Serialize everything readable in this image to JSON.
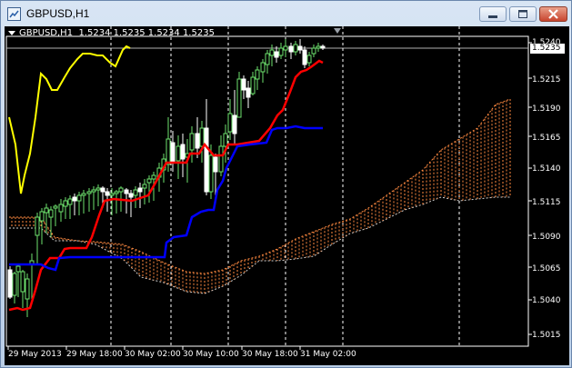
{
  "window": {
    "title": "GBPUSD,H1"
  },
  "ohlc": {
    "symbol": "GBPUSD,H1",
    "values": "1.5234 1.5235 1.5234 1.5235"
  },
  "current_price": "1.5235",
  "price_axis": [
    "1.5240",
    "1.5215",
    "1.5190",
    "1.5165",
    "1.5140",
    "1.5115",
    "1.5090",
    "1.5065",
    "1.5040",
    "1.5015"
  ],
  "time_axis": [
    "29 May 2013",
    "29 May 18:00",
    "30 May 02:00",
    "30 May 10:00",
    "30 May 18:00",
    "31 May 02:00"
  ],
  "colors": {
    "bull_candle": "#6ee26e",
    "bear_candle": "#ffffff",
    "tenkan": "#ff0000",
    "kijun": "#0000ff",
    "chikou": "#ffff00",
    "cloud_a": "#ff8a40",
    "cloud_b": "#cfcfcf"
  },
  "icons": [
    "chart-window-icon",
    "minimize-icon",
    "maximize-icon",
    "close-icon"
  ]
}
